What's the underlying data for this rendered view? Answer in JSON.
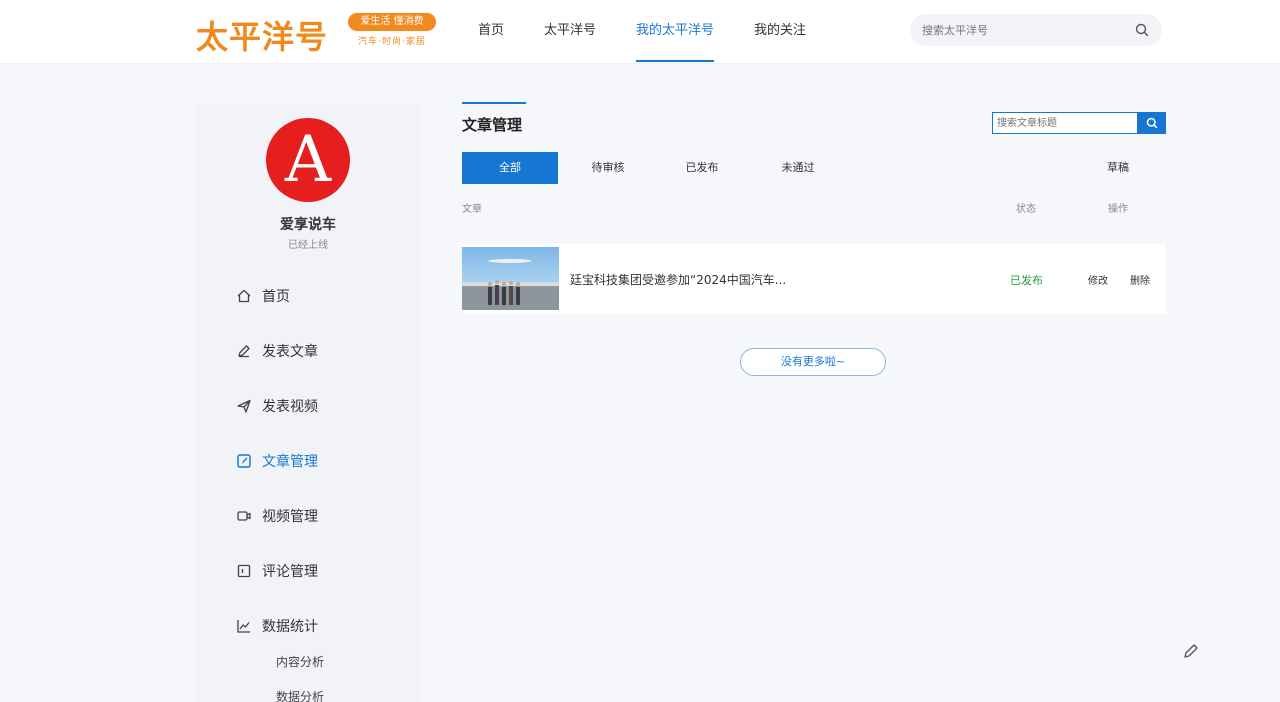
{
  "header": {
    "logo_text": "太平洋号",
    "logo_slogan": "爱生活 懂消费",
    "logo_sub": "汽车·时尚·家居",
    "nav": [
      "首页",
      "太平洋号",
      "我的太平洋号",
      "我的关注"
    ],
    "nav_active": 2,
    "search_placeholder": "搜索太平洋号"
  },
  "sidebar": {
    "avatar_letter": "A",
    "user_name": "爱享说车",
    "user_status": "已经上线",
    "items": [
      "首页",
      "发表文章",
      "发表视频",
      "文章管理",
      "视频管理",
      "评论管理",
      "数据统计"
    ],
    "active_index": 3,
    "sub_items": [
      "内容分析",
      "数据分析"
    ]
  },
  "main": {
    "title": "文章管理",
    "search_placeholder": "搜索文章标题",
    "tabs": [
      "全部",
      "待审核",
      "已发布",
      "未通过",
      "草稿"
    ],
    "active_tab": 0,
    "columns": [
      "文章",
      "状态",
      "操作"
    ],
    "rows": [
      {
        "title": "廷宝科技集团受邀参加“2024中国汽车...",
        "status": "已发布",
        "actions": [
          "修改",
          "删除"
        ]
      }
    ],
    "more_label": "没有更多啦~"
  },
  "colors": {
    "brand": "#f08a1c",
    "accent": "#1677d2",
    "success": "#2a9d3c",
    "avatar_bg": "#e61e1e"
  }
}
